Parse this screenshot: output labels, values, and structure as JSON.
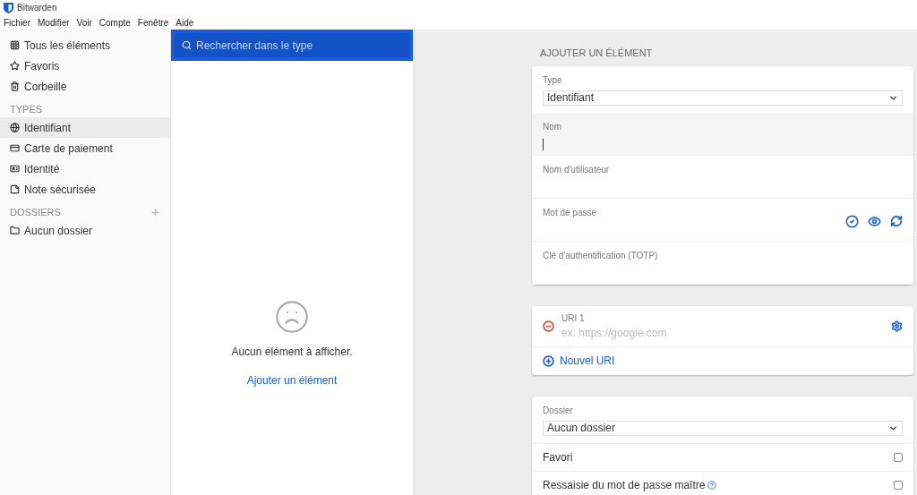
{
  "window": {
    "title": "Bitwarden"
  },
  "menu": [
    "Fichier",
    "Modifier",
    "Voir",
    "Compte",
    "Fenêtre",
    "Aide"
  ],
  "sidebar": {
    "groups": [
      {
        "items": [
          {
            "label": "Tous les éléments",
            "kind": "grid",
            "selected": false
          },
          {
            "label": "Favoris",
            "kind": "star",
            "selected": false
          },
          {
            "label": "Corbeille",
            "kind": "trash",
            "selected": false
          }
        ]
      },
      {
        "heading": "TYPES",
        "items": [
          {
            "label": "Identifiant",
            "kind": "globe",
            "selected": true
          },
          {
            "label": "Carte de paiement",
            "kind": "card",
            "selected": false
          },
          {
            "label": "Identité",
            "kind": "id",
            "selected": false
          },
          {
            "label": "Note sécurisée",
            "kind": "note",
            "selected": false
          }
        ]
      },
      {
        "heading": "DOSSIERS",
        "add": true,
        "items": [
          {
            "label": "Aucun dossier",
            "kind": "folder",
            "selected": false
          }
        ]
      }
    ]
  },
  "search": {
    "placeholder": "Rechercher dans le type"
  },
  "empty_state": {
    "message": "Aucun élément à afficher.",
    "link": "Ajouter un élément"
  },
  "form": {
    "heading": "AJOUTER UN ÉLÉMENT",
    "type_field": {
      "label": "Type",
      "value": "Identifiant"
    },
    "fields": [
      {
        "label": "Nom",
        "kind": "text",
        "focused": true
      },
      {
        "label": "Nom d'utilisateur",
        "kind": "text",
        "focused": false
      },
      {
        "label": "Mot de passe",
        "kind": "password",
        "focused": false
      },
      {
        "label": "Clé d'authentification (TOTP)",
        "kind": "text",
        "focused": false
      }
    ],
    "uris": [
      {
        "label": "URI 1",
        "placeholder": "ex. https://google.com"
      }
    ],
    "add_uri": "Nouvel URI",
    "folder_field": {
      "label": "Dossier",
      "value": "Aucun dossier"
    },
    "options": [
      {
        "label": "Favori",
        "checked": false,
        "help": false
      },
      {
        "label": "Ressaisie du mot de passe maître",
        "checked": false,
        "help": true
      }
    ]
  }
}
